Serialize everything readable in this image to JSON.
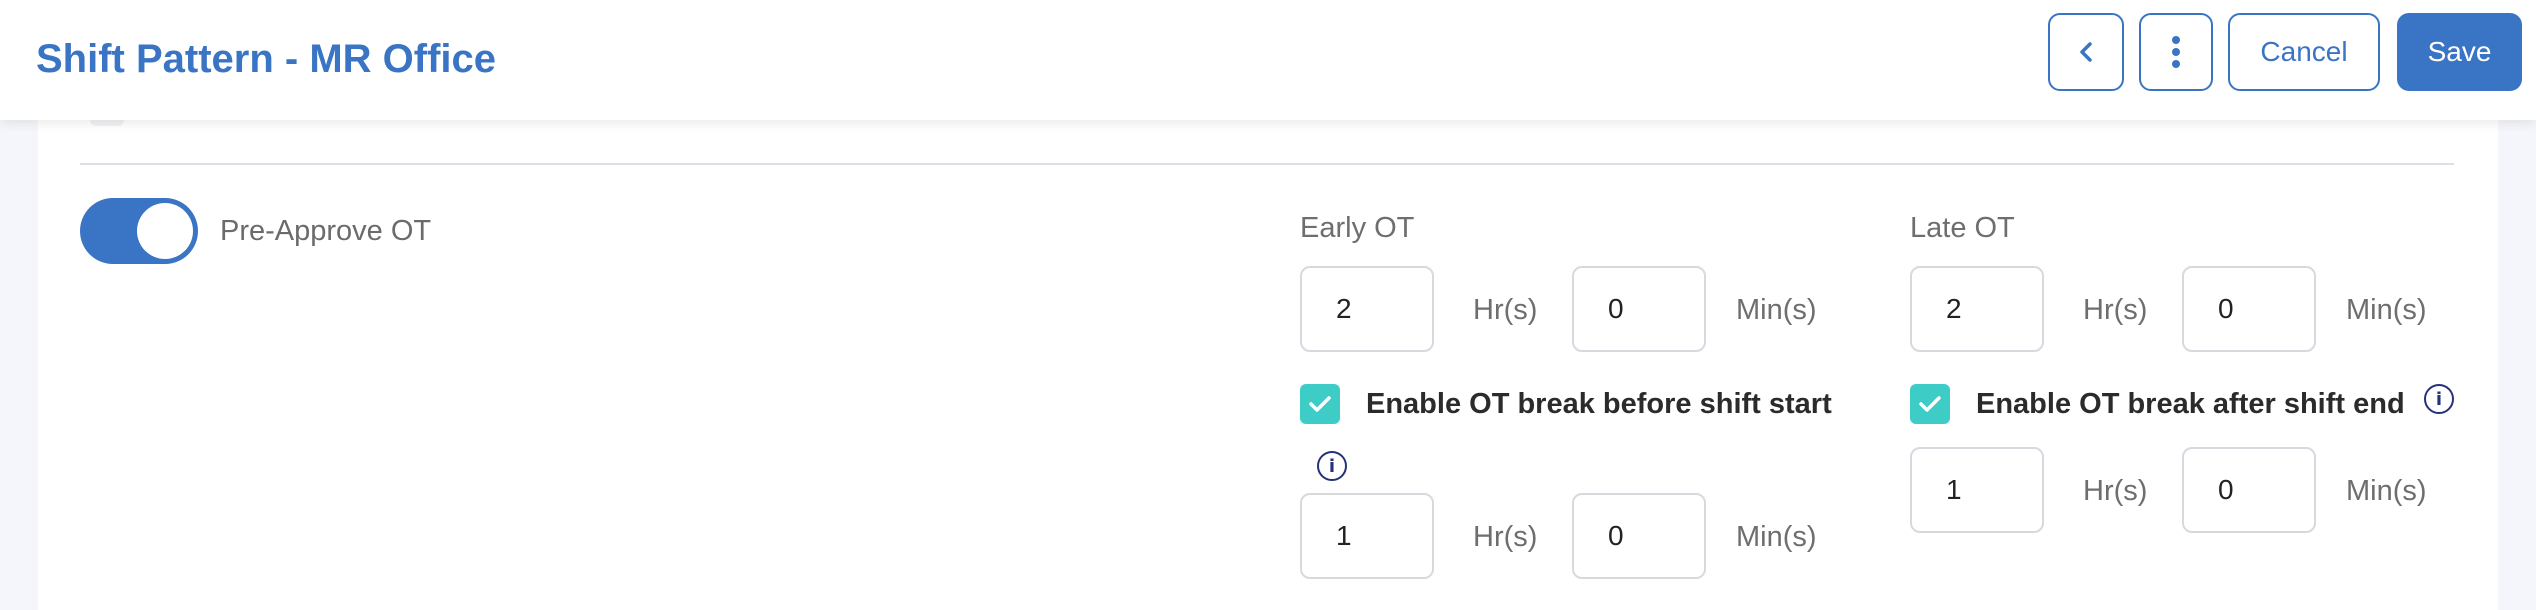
{
  "header": {
    "title": "Shift Pattern - MR Office",
    "cancel_label": "Cancel",
    "save_label": "Save"
  },
  "pre_approve": {
    "label": "Pre-Approve OT",
    "enabled": true
  },
  "early_ot": {
    "title": "Early OT",
    "hours": "2",
    "minutes": "0",
    "hours_unit": "Hr(s)",
    "minutes_unit": "Min(s)",
    "break_checkbox_label": "Enable OT break before shift start",
    "break_checked": true,
    "break_hours": "1",
    "break_minutes": "0"
  },
  "late_ot": {
    "title": "Late OT",
    "hours": "2",
    "minutes": "0",
    "hours_unit": "Hr(s)",
    "minutes_unit": "Min(s)",
    "break_checkbox_label": "Enable OT break after shift end",
    "break_checked": true,
    "break_hours": "1",
    "break_minutes": "0"
  },
  "colors": {
    "brand": "#3a74c4",
    "checkbox": "#3ecdc6",
    "info_icon": "#25327a"
  },
  "info_icon_glyph": "i"
}
